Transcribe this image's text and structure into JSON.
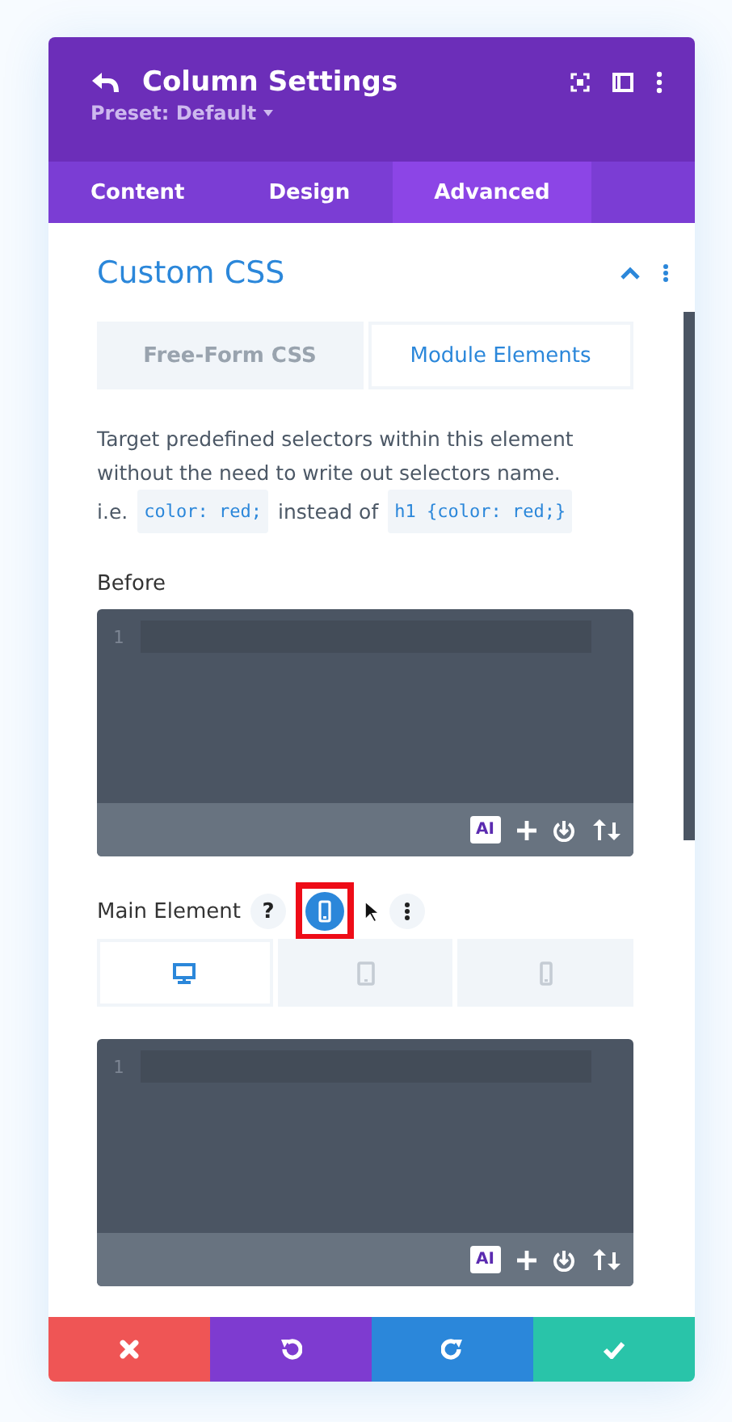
{
  "header": {
    "title": "Column Settings",
    "preset": "Preset: Default"
  },
  "tabs": [
    {
      "label": "Content",
      "selected": false
    },
    {
      "label": "Design",
      "selected": false
    },
    {
      "label": "Advanced",
      "selected": true
    }
  ],
  "section": {
    "title": "Custom CSS",
    "expanded": true
  },
  "subtabs": [
    {
      "label": "Free-Form CSS",
      "selected": false
    },
    {
      "label": "Module Elements",
      "selected": true
    }
  ],
  "description": {
    "text": "Target predefined selectors within this element without the need to write out selectors name.",
    "example_prefix": "i.e.",
    "example_code": "color: red;",
    "example_middle": "instead of",
    "example_code_2": "h1 {color: red;}"
  },
  "fields": [
    {
      "kind": "plain",
      "label": "Before",
      "line_number": "1",
      "ai_label": "AI"
    },
    {
      "kind": "responsive",
      "label": "Main Element",
      "help_label": "?",
      "line_number": "1",
      "ai_label": "AI",
      "devices": [
        {
          "kind": "desktop",
          "selected": true
        },
        {
          "kind": "tablet",
          "selected": false
        },
        {
          "kind": "phone",
          "selected": false
        }
      ],
      "phone_toggle_highlighted": true
    }
  ],
  "footer": [
    {
      "kind": "cancel",
      "color": "#ef5555"
    },
    {
      "kind": "undo",
      "color": "#7e3bd0"
    },
    {
      "kind": "redo",
      "color": "#2b87da"
    },
    {
      "kind": "save",
      "color": "#29c4a9"
    }
  ]
}
